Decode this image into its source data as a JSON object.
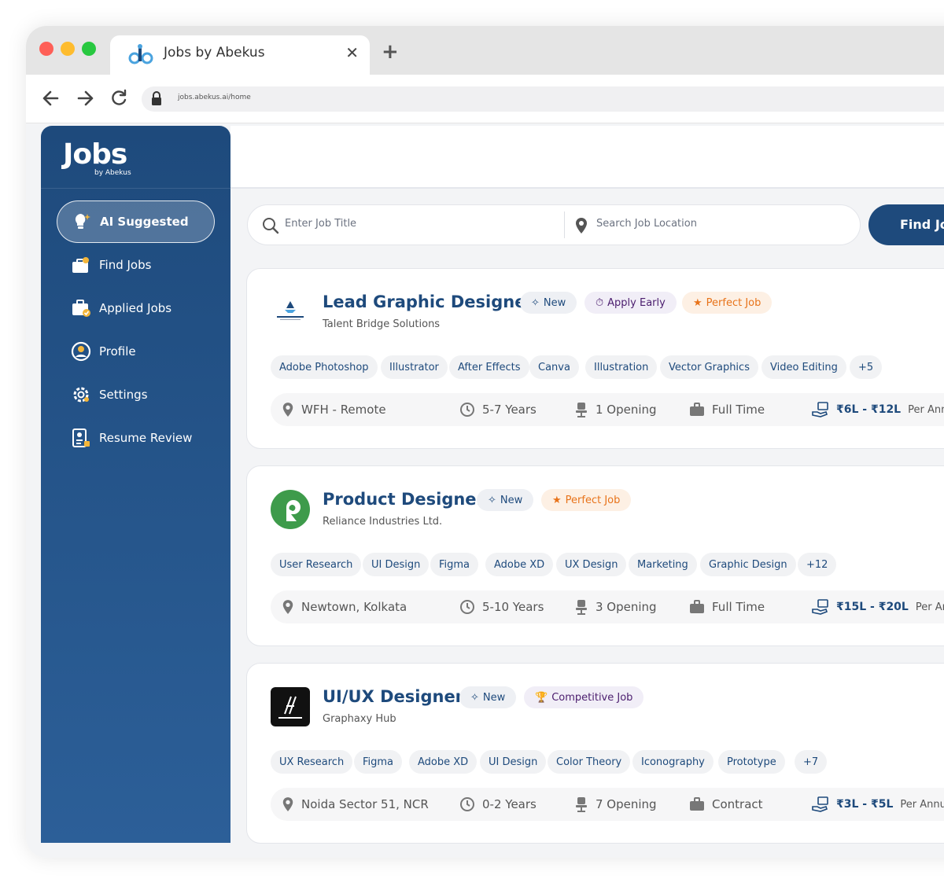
{
  "browser": {
    "tab_title": "Jobs by Abekus",
    "url": "jobs.abekus.ai/home"
  },
  "sidebar": {
    "logo": "Jobs",
    "logo_sub": "by Abekus",
    "items": [
      {
        "label": "AI Suggested",
        "icon": "lightbulb-icon",
        "active": true
      },
      {
        "label": "Find Jobs",
        "icon": "briefcase-search-icon"
      },
      {
        "label": "Applied Jobs",
        "icon": "briefcase-check-icon"
      },
      {
        "label": "Profile",
        "icon": "user-circle-icon"
      },
      {
        "label": "Settings",
        "icon": "gear-icon"
      },
      {
        "label": "Resume Review",
        "icon": "resume-icon"
      }
    ]
  },
  "search": {
    "title_placeholder": "Enter Job Title",
    "location_placeholder": "Search Job Location",
    "button": "Find Jo"
  },
  "jobs": [
    {
      "title": "Lead Graphic Designer",
      "company": "Talent Bridge Solutions",
      "badges": [
        "New",
        "Apply Early",
        "Perfect Job"
      ],
      "skills": [
        "Adobe Photoshop",
        "Illustrator",
        "After Effects",
        "Canva",
        "Illustration",
        "Vector Graphics",
        "Video Editing",
        "+5"
      ],
      "location": "WFH - Remote",
      "experience": "5-7 Years",
      "openings": "1 Opening",
      "type": "Full Time",
      "salary": "₹6L - ₹12L",
      "salary_period": "Per Annum"
    },
    {
      "title": "Product Designer",
      "company": "Reliance Industries Ltd.",
      "badges": [
        "New",
        "Perfect Job"
      ],
      "skills": [
        "User Research",
        "UI Design",
        "Figma",
        "Adobe XD",
        "UX Design",
        "Marketing",
        "Graphic Design",
        "+12"
      ],
      "location": "Newtown, Kolkata",
      "experience": "5-10 Years",
      "openings": "3 Opening",
      "type": "Full Time",
      "salary": "₹15L - ₹20L",
      "salary_period": "Per Annum"
    },
    {
      "title": "UI/UX Designer",
      "company": "Graphaxy Hub",
      "badges": [
        "New",
        "Competitive Job"
      ],
      "skills": [
        "UX Research",
        "Figma",
        "Adobe XD",
        "UI Design",
        "Color Theory",
        "Iconography",
        "Prototype",
        "+7"
      ],
      "location": "Noida Sector 51, NCR",
      "experience": "0-2 Years",
      "openings": "7 Opening",
      "type": "Contract",
      "salary": "₹3L - ₹5L",
      "salary_period": "Per Annum"
    }
  ],
  "colors": {
    "primary": "#1e4a7c",
    "accent_orange": "#e8731a",
    "accent_purple": "#4b1d6e"
  }
}
